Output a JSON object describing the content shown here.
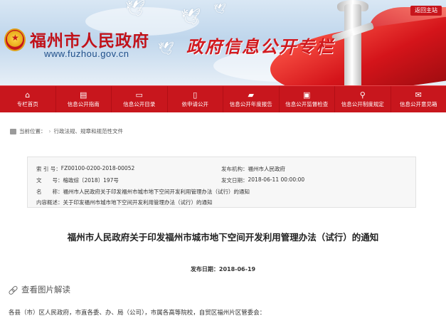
{
  "header": {
    "site_title": "福州市人民政府",
    "site_url": "www.fuzhou.gov.cn",
    "column_title": "政府信息公开专栏",
    "return_home": "返回主站"
  },
  "nav": {
    "items": [
      {
        "label": "专栏首页",
        "icon": "home-icon"
      },
      {
        "label": "信息公开指南",
        "icon": "guide-icon"
      },
      {
        "label": "信息公开目录",
        "icon": "catalog-icon"
      },
      {
        "label": "依申请公开",
        "icon": "application-icon"
      },
      {
        "label": "信息公开年度报告",
        "icon": "folder-icon"
      },
      {
        "label": "信息公开监督检查",
        "icon": "inspection-icon"
      },
      {
        "label": "信息公开制度规定",
        "icon": "regulation-icon"
      },
      {
        "label": "信息公开意见箱",
        "icon": "mailbox-icon"
      }
    ]
  },
  "breadcrumb": {
    "prefix": "当前位置：",
    "path": "行政法规、规章和规范性文件"
  },
  "info": {
    "index_label": "索 引 号：",
    "index_value": "FZ00100-0200-2018-00052",
    "org_label": "发布机构：",
    "org_value": "福州市人民政府",
    "docno_label": "文　　号：",
    "docno_value": "榕政综〔2018〕197号",
    "date_label": "发文日期：",
    "date_value": "2018-06-11 00:00:00",
    "name_label": "名　　称：",
    "name_value": "福州市人民政府关于印发福州市城市地下空间开发利用管理办法（试行）的通知",
    "summary_label": "内容概述：",
    "summary_value": "关于印发福州市城市地下空间开发利用管理办法（试行）的通知"
  },
  "article": {
    "title": "福州市人民政府关于印发福州市城市地下空间开发利用管理办法（试行）的通知",
    "pub_date_label": "发布日期：",
    "pub_date_value": "2018-06-19",
    "image_reading": "查看图片解读",
    "body_first_line": "各县（市）区人民政府，市直各委、办、局（公司），市属各高等院校，自贸区福州片区管委会："
  }
}
